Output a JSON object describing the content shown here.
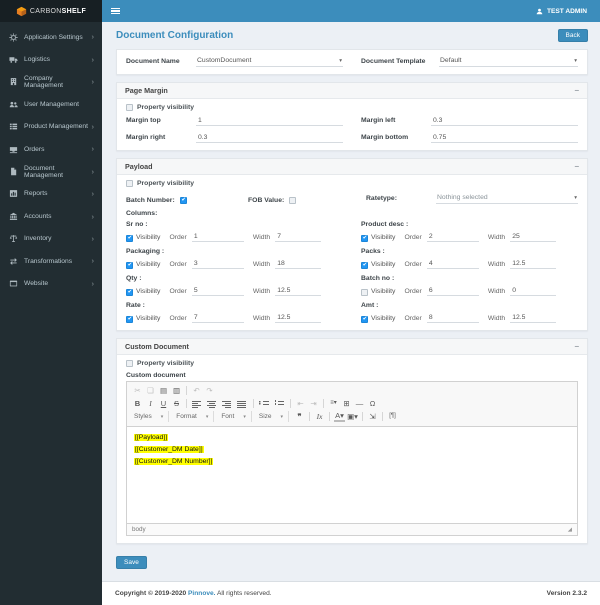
{
  "ui": {
    "collapse_glyph": "−",
    "caret_glyph": "▾",
    "chevron_glyph": "›"
  },
  "colors": {
    "accent": "#3c8dbc",
    "sidebar_bg": "#222d32",
    "highlight": "#ffff00",
    "checkbox_checked": "#2196f3"
  },
  "header": {
    "brand_bold": "CARBON",
    "brand_rest": "SHELF",
    "user": "TEST ADMIN"
  },
  "sidebar": {
    "items": [
      {
        "label": "Application Settings",
        "icon": "gear-icon",
        "chevron": true
      },
      {
        "label": "Logistics",
        "icon": "truck-icon",
        "chevron": true
      },
      {
        "label": "Company Management",
        "icon": "building-icon",
        "chevron": true
      },
      {
        "label": "User Management",
        "icon": "users-icon",
        "chevron": false
      },
      {
        "label": "Product Management",
        "icon": "product-grid-icon",
        "chevron": true
      },
      {
        "label": "Orders",
        "icon": "inbox-icon",
        "chevron": true
      },
      {
        "label": "Document Management",
        "icon": "document-icon",
        "chevron": true
      },
      {
        "label": "Reports",
        "icon": "chart-icon",
        "chevron": true
      },
      {
        "label": "Accounts",
        "icon": "bank-icon",
        "chevron": true
      },
      {
        "label": "Inventory",
        "icon": "scale-icon",
        "chevron": true
      },
      {
        "label": "Transformations",
        "icon": "exchange-icon",
        "chevron": true
      },
      {
        "label": "Website",
        "icon": "browser-icon",
        "chevron": true
      }
    ]
  },
  "page": {
    "title": "Document Configuration",
    "back_label": "Back"
  },
  "doc_form": {
    "name_label": "Document Name",
    "name_value": "CustomDocument",
    "template_label": "Document Template",
    "template_value": "Default"
  },
  "page_margin": {
    "title": "Page Margin",
    "property_visibility_label": "Property visibility",
    "fields": [
      {
        "label": "Margin top",
        "value": "1"
      },
      {
        "label": "Margin left",
        "value": "0.3"
      },
      {
        "label": "Margin right",
        "value": "0.3"
      },
      {
        "label": "Margin bottom",
        "value": "0.75"
      }
    ]
  },
  "payload": {
    "title": "Payload",
    "property_visibility_label": "Property visibility",
    "batch_number_label": "Batch Number:",
    "batch_number_checked": true,
    "fob_value_label": "FOB Value:",
    "fob_value_checked": false,
    "ratetype_label": "Ratetype:",
    "ratetype_value": "Nothing selected",
    "columns_label": "Columns:",
    "visibility_label": "Visibility",
    "order_label": "Order",
    "width_label": "Width",
    "columns": [
      {
        "name": "Sr no :",
        "visible": true,
        "order": "1",
        "width": "7"
      },
      {
        "name": "Product desc :",
        "visible": true,
        "order": "2",
        "width": "25"
      },
      {
        "name": "Packaging :",
        "visible": true,
        "order": "3",
        "width": "18"
      },
      {
        "name": "Packs :",
        "visible": true,
        "order": "4",
        "width": "12.5"
      },
      {
        "name": "Qty :",
        "visible": true,
        "order": "5",
        "width": "12.5"
      },
      {
        "name": "Batch no :",
        "visible": false,
        "order": "6",
        "width": "0"
      },
      {
        "name": "Rate :",
        "visible": true,
        "order": "7",
        "width": "12.5"
      },
      {
        "name": "Amt :",
        "visible": true,
        "order": "8",
        "width": "12.5"
      }
    ]
  },
  "custom_document": {
    "title": "Custom Document",
    "property_visibility_label": "Property visibility",
    "field_label": "Custom document",
    "save_label": "Save"
  },
  "editor": {
    "toolbar1": [
      {
        "name": "cut-icon",
        "glyph": "✂",
        "cls": "dim"
      },
      {
        "name": "copy-icon",
        "glyph": "❏",
        "cls": "dim"
      },
      {
        "name": "paste-icon",
        "glyph": "▤",
        "cls": ""
      },
      {
        "name": "paste-from-word-icon",
        "glyph": "▥",
        "cls": ""
      },
      {
        "name": "separator",
        "glyph": "",
        "cls": "sep"
      },
      {
        "name": "undo-icon",
        "glyph": "↶",
        "cls": "dim"
      },
      {
        "name": "redo-icon",
        "glyph": "↷",
        "cls": "dim"
      }
    ],
    "toolbar2": [
      {
        "name": "bold-icon",
        "glyph": "B",
        "cls": "b"
      },
      {
        "name": "italic-icon",
        "glyph": "I",
        "cls": "i"
      },
      {
        "name": "underline-icon",
        "glyph": "U",
        "cls": "u"
      },
      {
        "name": "strikethrough-icon",
        "glyph": "S",
        "cls": "s"
      },
      {
        "name": "separator",
        "glyph": "",
        "cls": "sep"
      },
      {
        "name": "align-left-icon",
        "glyph": "",
        "cls": "lic ic-al"
      },
      {
        "name": "align-center-icon",
        "glyph": "",
        "cls": "lic ic-ac"
      },
      {
        "name": "align-right-icon",
        "glyph": "",
        "cls": "lic ic-ar"
      },
      {
        "name": "align-justify-icon",
        "glyph": "",
        "cls": "lic ic-aj"
      },
      {
        "name": "separator",
        "glyph": "",
        "cls": "sep"
      },
      {
        "name": "bulleted-list-icon",
        "glyph": "",
        "cls": "lic ic-ul"
      },
      {
        "name": "numbered-list-icon",
        "glyph": "",
        "cls": "lic ic-ol"
      },
      {
        "name": "separator",
        "glyph": "",
        "cls": "sep"
      },
      {
        "name": "outdent-icon",
        "glyph": "⇤",
        "cls": "dim"
      },
      {
        "name": "indent-icon",
        "glyph": "⇥",
        "cls": "dim"
      },
      {
        "name": "separator",
        "glyph": "",
        "cls": "sep"
      },
      {
        "name": "blocks-dropdown-icon",
        "glyph": "≡▾",
        "cls": "small"
      },
      {
        "name": "table-icon",
        "glyph": "⊞",
        "cls": ""
      },
      {
        "name": "horizontal-rule-icon",
        "glyph": "―",
        "cls": ""
      },
      {
        "name": "special-character-icon",
        "glyph": "Ω",
        "cls": ""
      }
    ],
    "combos": [
      "Styles",
      "Format",
      "Font",
      "Size"
    ],
    "toolbar3": [
      {
        "name": "blockquote-icon",
        "glyph": "❞",
        "cls": "b"
      },
      {
        "name": "separator",
        "glyph": "",
        "cls": "sep"
      },
      {
        "name": "remove-format-icon",
        "glyph": "Ix",
        "cls": "i"
      },
      {
        "name": "separator",
        "glyph": "",
        "cls": "sep"
      },
      {
        "name": "text-color-icon",
        "glyph": "A▾",
        "cls": "clrA"
      },
      {
        "name": "bg-color-icon",
        "glyph": "▣▾",
        "cls": ""
      },
      {
        "name": "separator",
        "glyph": "",
        "cls": "sep"
      },
      {
        "name": "maximize-icon",
        "glyph": "⇲",
        "cls": ""
      },
      {
        "name": "separator",
        "glyph": "",
        "cls": "sep"
      },
      {
        "name": "show-blocks-icon",
        "glyph": "[¶]",
        "cls": "small"
      }
    ],
    "content_lines": [
      "[[Payload]]",
      "[[Customer_DM Date]]",
      "[[Customer_DM Number]]"
    ],
    "status_bar": "body"
  },
  "footer": {
    "copyright_prefix": "Copyright © 2019-2020 ",
    "brand": "Pinnove.",
    "copyright_suffix": " All rights reserved.",
    "version_label": "Version ",
    "version_value": "2.3.2"
  }
}
